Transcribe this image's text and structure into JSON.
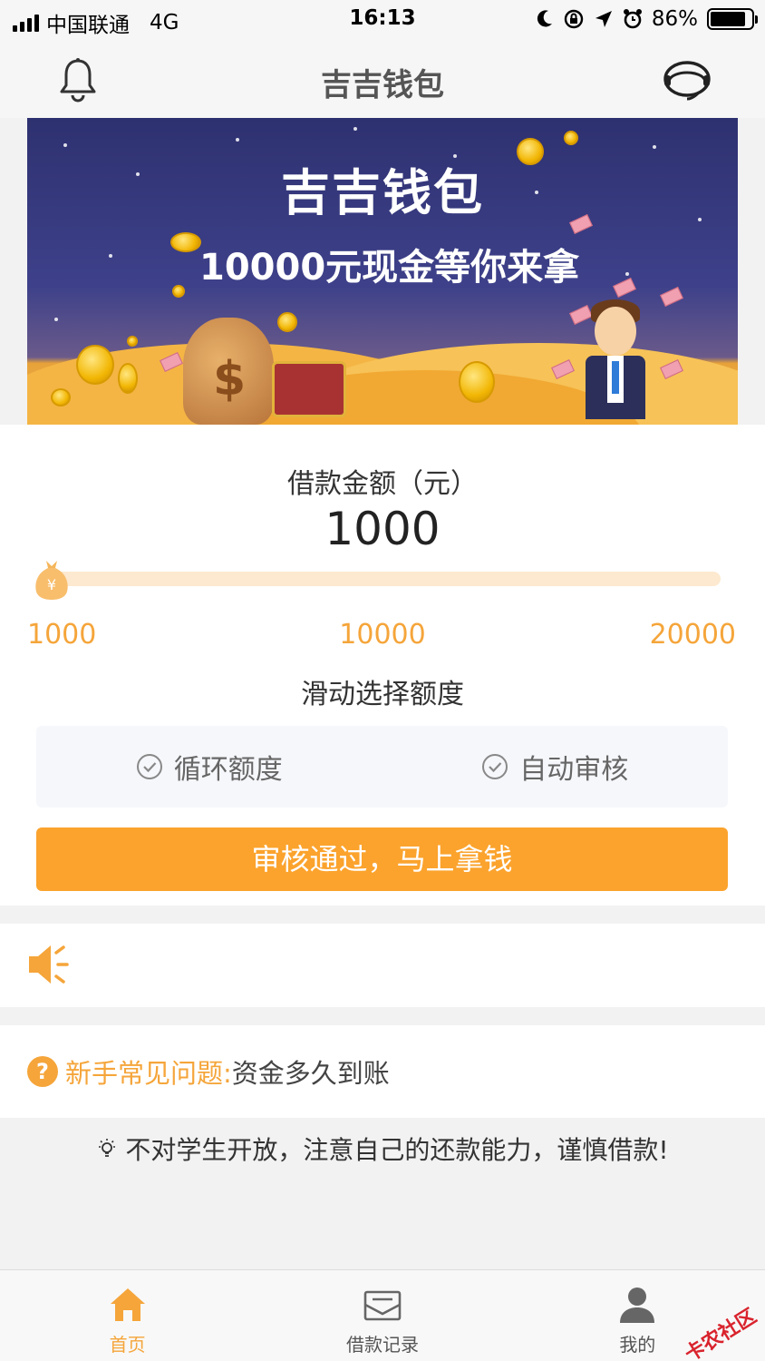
{
  "status_bar": {
    "carrier": "中国联通",
    "network": "4G",
    "time": "16:13",
    "battery": "86%",
    "battery_level": 0.86
  },
  "nav": {
    "title": "吉吉钱包",
    "left_icon": "bell-icon",
    "right_icon": "customer-service-icon"
  },
  "banner": {
    "title": "吉吉钱包",
    "subtitle": "10000元现金等你来拿"
  },
  "loan": {
    "label": "借款金额（元）",
    "amount": "1000",
    "slider_value": 1000,
    "slider_min": "1000",
    "slider_mid": "10000",
    "slider_max": "20000",
    "hint": "滑动选择额度",
    "features": [
      {
        "label": "循环额度",
        "icon": "check-circle-icon"
      },
      {
        "label": "自动审核",
        "icon": "check-circle-icon"
      }
    ],
    "cta_label": "审核通过，马上拿钱"
  },
  "notice": {
    "icon": "speaker-icon"
  },
  "faq": {
    "icon_glyph": "?",
    "prefix": "新手常见问题:",
    "question": "资金多久到账"
  },
  "tip": {
    "icon": "lightbulb-icon",
    "text": "不对学生开放，注意自己的还款能力，谨慎借款!"
  },
  "tabs": [
    {
      "label": "首页",
      "icon": "home-icon",
      "active": true
    },
    {
      "label": "借款记录",
      "icon": "mail-icon",
      "active": false
    },
    {
      "label": "我的",
      "icon": "user-icon",
      "active": false
    }
  ],
  "watermark": "卡农社区",
  "colors": {
    "accent": "#fba32d",
    "scale_text": "#f5a53a",
    "track": "#fde9cf"
  }
}
